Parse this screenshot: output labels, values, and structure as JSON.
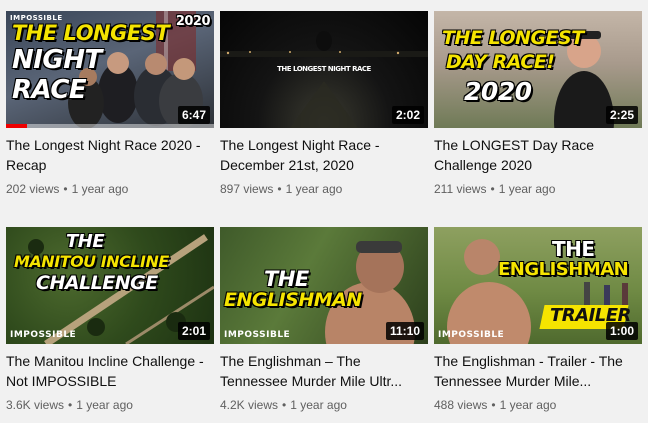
{
  "videos": [
    {
      "title": "The Longest Night Race 2020 - Recap",
      "views": "202 views",
      "age": "1 year ago",
      "duration": "6:47",
      "progress": 0.1,
      "thumb_text": [
        "THE LONGEST",
        "NIGHT",
        "RACE"
      ],
      "thumb_corner": "2020",
      "thumb_brand": "IMPOSSIBLE"
    },
    {
      "title": "The Longest Night Race - December 21st, 2020",
      "views": "897 views",
      "age": "1 year ago",
      "duration": "2:02",
      "thumb_text": [
        "THE LONGEST NIGHT RACE"
      ]
    },
    {
      "title": "The LONGEST Day Race Challenge 2020",
      "views": "211 views",
      "age": "1 year ago",
      "duration": "2:25",
      "thumb_text": [
        "THE LONGEST",
        "DAY RACE!",
        "2020"
      ]
    },
    {
      "title": "The Manitou Incline Challenge - Not IMPOSSIBLE",
      "views": "3.6K views",
      "age": "1 year ago",
      "duration": "2:01",
      "thumb_text": [
        "THE",
        "MANITOU INCLINE",
        "CHALLENGE"
      ],
      "thumb_brand": "IMPOSSIBLE"
    },
    {
      "title": "The Englishman – The Tennessee Murder Mile Ultr...",
      "views": "4.2K views",
      "age": "1 year ago",
      "duration": "11:10",
      "thumb_text": [
        "THE",
        "ENGLISHMAN"
      ],
      "thumb_brand": "IMPOSSIBLE"
    },
    {
      "title": "The Englishman - Trailer - The Tennessee Murder Mile...",
      "views": "488 views",
      "age": "1 year ago",
      "duration": "1:00",
      "thumb_text": [
        "THE",
        "ENGLISHMAN",
        "TRAILER"
      ],
      "thumb_brand": "IMPOSSIBLE"
    }
  ],
  "separator": "•",
  "colors": {
    "meta": "#606060",
    "title": "#0f0f0f",
    "progress": "#e00000",
    "thumb_yellow": "#f5e400"
  }
}
